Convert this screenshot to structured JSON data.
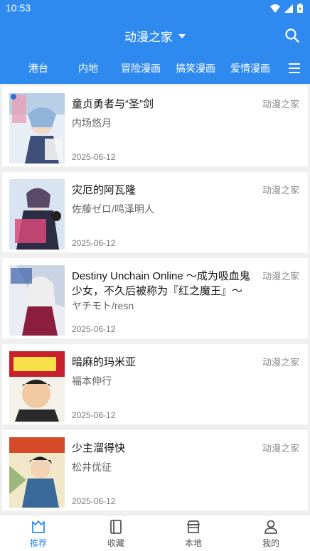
{
  "status_bar": {
    "time": "10:53"
  },
  "app_bar": {
    "title": "动漫之家"
  },
  "tabs": [
    "港台",
    "内地",
    "冒险漫画",
    "搞笑漫画",
    "爱情漫画"
  ],
  "comics": [
    {
      "title": "童贞勇者与“圣”剑",
      "author": "内场悠月",
      "source": "动漫之家",
      "date": "2025-06-12"
    },
    {
      "title": "灾厄的阿瓦隆",
      "author": "佐藤ゼロ/鸣泽明人",
      "source": "动漫之家",
      "date": "2025-06-12"
    },
    {
      "title": "Destiny Unchain Online ～成为吸血鬼少女，不久后被称为『红之魔王』～",
      "title_line1": "Destiny Unchain Online ～成为吸血鬼",
      "title_line2": "少女，不久后被称为『红之魔王』～",
      "author": "ヤチモト/resn",
      "source": "动漫之家",
      "date": "2025-06-12"
    },
    {
      "title": "暗麻的玛米亚",
      "author": "福本伸行",
      "source": "动漫之家",
      "date": "2025-06-12"
    },
    {
      "title": "少主溜得快",
      "author": "松井优征",
      "source": "动漫之家",
      "date": "2025-06-12"
    }
  ],
  "bottom_nav": [
    {
      "label": "推荐",
      "icon": "recommend-icon",
      "active": true
    },
    {
      "label": "收藏",
      "icon": "book-icon",
      "active": false
    },
    {
      "label": "本地",
      "icon": "store-icon",
      "active": false
    },
    {
      "label": "我的",
      "icon": "person-icon",
      "active": false
    }
  ],
  "colors": {
    "primary": "#2f8af0",
    "background": "#f0f0f0",
    "card": "#ffffff"
  }
}
